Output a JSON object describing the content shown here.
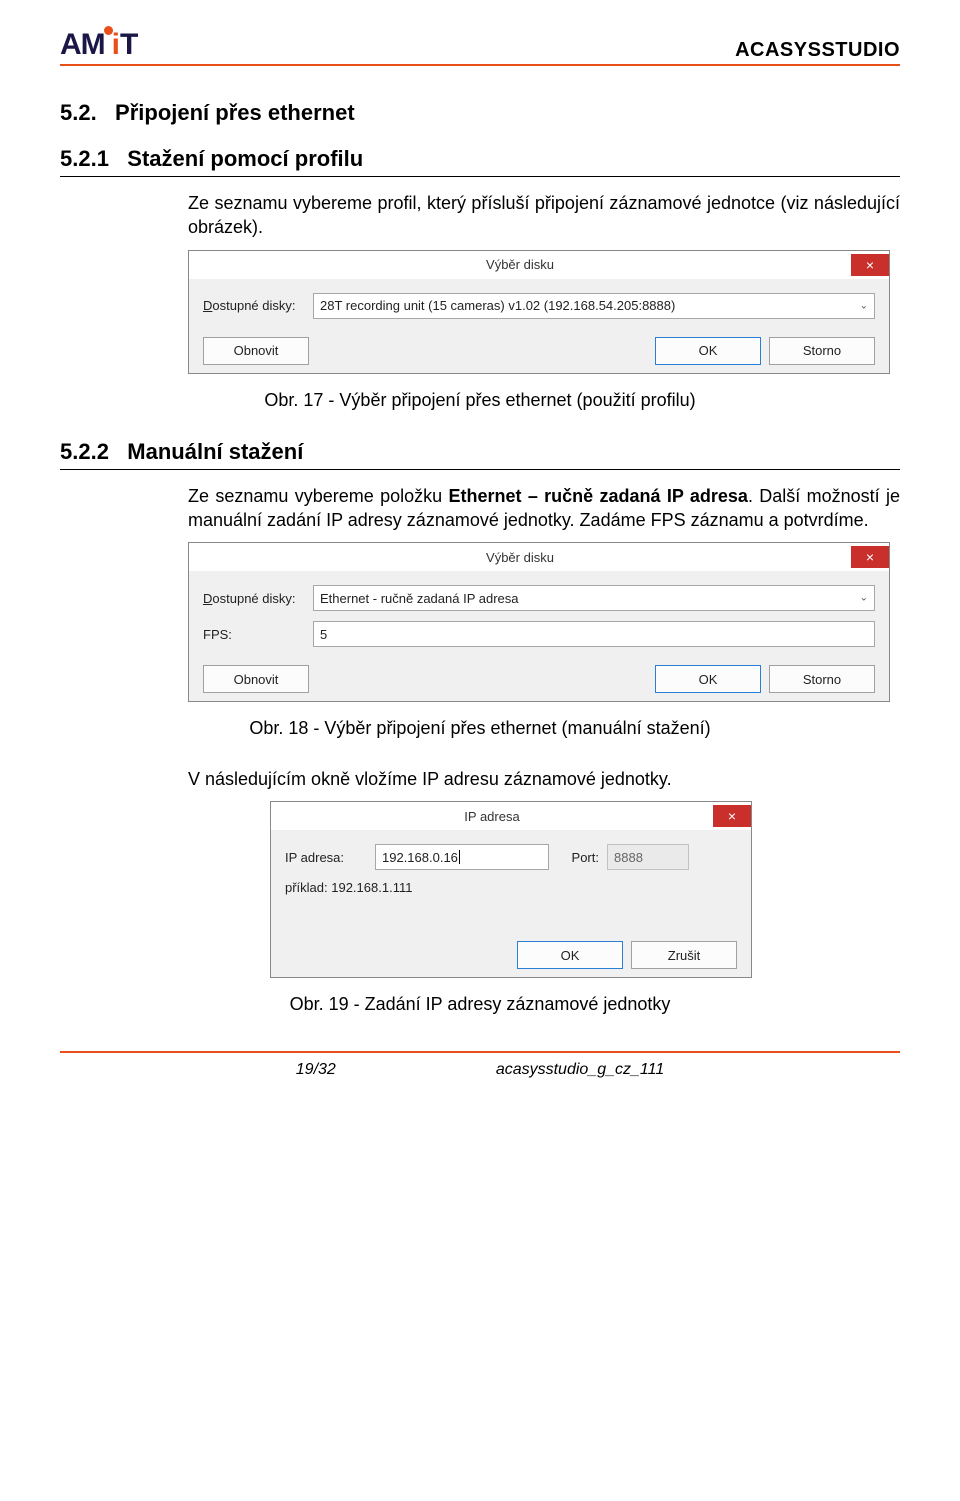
{
  "product": "ACASYSSTUDIO",
  "logo_text": "AMiT",
  "section_52_num": "5.2.",
  "section_52_title": "Připojení přes ethernet",
  "section_521_num": "5.2.1",
  "section_521_title": "Stažení pomocí profilu",
  "para_521": "Ze seznamu vybereme profil, který přísluší připojení záznamové jednotce (viz následující obrázek).",
  "dialog1": {
    "title": "Výběr disku",
    "close": "×",
    "disks_label": "Dostupné disky:",
    "disks_value": "28T recording unit (15 cameras) v1.02 (192.168.54.205:8888)",
    "refresh": "Obnovit",
    "ok": "OK",
    "cancel": "Storno"
  },
  "caption17": "Obr. 17 - Výběr připojení přes ethernet (použití profilu)",
  "section_522_num": "5.2.2",
  "section_522_title": "Manuální stažení",
  "para_522": "Ze seznamu vybereme položku Ethernet – ručně zadaná IP adresa. Další možností je manuální zadání IP adresy záznamové jednotky. Zadáme FPS záznamu a potvrdíme.",
  "para_522_bold": "Ethernet – ručně zadaná IP adresa",
  "dialog2": {
    "title": "Výběr disku",
    "close": "×",
    "disks_label": "Dostupné disky:",
    "disks_value": "Ethernet - ručně zadaná IP adresa",
    "fps_label": "FPS:",
    "fps_value": "5",
    "refresh": "Obnovit",
    "ok": "OK",
    "cancel": "Storno"
  },
  "caption18": "Obr. 18 - Výběr připojení přes ethernet (manuální stažení)",
  "para_after18": "V následujícím okně vložíme IP adresu záznamové jednotky.",
  "dialog3": {
    "title": "IP adresa",
    "close": "×",
    "ip_label": "IP adresa:",
    "ip_value": "192.168.0.16",
    "port_label": "Port:",
    "port_value": "8888",
    "example": "příklad: 192.168.1.111",
    "ok": "OK",
    "cancel": "Zrušit"
  },
  "caption19": "Obr. 19 - Zadání IP adresy záznamové jednotky",
  "footer_page": "19/32",
  "footer_doc": "acasysstudio_g_cz_111"
}
